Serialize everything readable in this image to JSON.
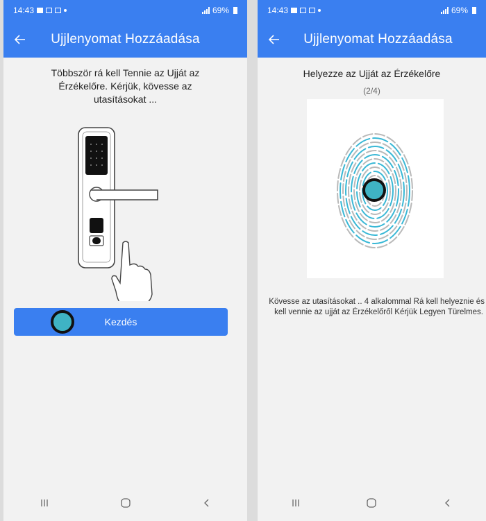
{
  "left_screen": {
    "status": {
      "time": "14:43",
      "battery": "69%"
    },
    "appbar": {
      "title": "Ujjlenyomat Hozzáadása"
    },
    "instruction": "Többször rá kell Tennie az Ujját az Érzékelőre. Kérjük, kövesse az utasításokat ...",
    "start_button": "Kezdés"
  },
  "right_screen": {
    "status": {
      "time": "14:43",
      "battery": "69%"
    },
    "appbar": {
      "title": "Ujjlenyomat Hozzáadása"
    },
    "place_title": "Helyezze az Ujját az Érzékelőre",
    "progress": "(2/4)",
    "note_line1": "Kövesse az utasításokat .. 4 alkalommal Rá kell helyeznie és l",
    "note_line2": "kell vennie az ujját az Érzékelőről  Kérjük Legyen Türelmes."
  },
  "colors": {
    "primary": "#3a7ff0",
    "touch_marker": "#3fb3c4",
    "fingerprint_accent": "#39b8d6"
  },
  "icons": {
    "back": "arrow-left-icon",
    "nav_recent": "recent-apps-icon",
    "nav_home": "home-icon",
    "nav_back": "chevron-left-icon"
  }
}
